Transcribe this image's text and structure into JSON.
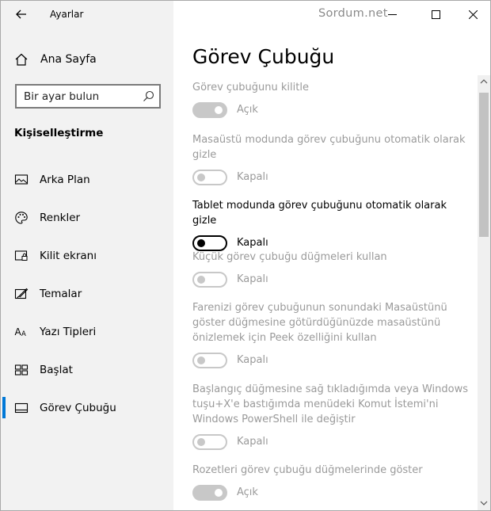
{
  "window": {
    "app_title": "Ayarlar",
    "watermark": "Sordum.net"
  },
  "sidebar": {
    "home_label": "Ana Sayfa",
    "search_placeholder": "Bir ayar bulun",
    "section_title": "Kişiselleştirme",
    "items": [
      {
        "label": "Arka Plan",
        "icon": "picture-icon"
      },
      {
        "label": "Renkler",
        "icon": "palette-icon"
      },
      {
        "label": "Kilit ekranı",
        "icon": "lock-screen-icon"
      },
      {
        "label": "Temalar",
        "icon": "brush-icon"
      },
      {
        "label": "Yazı Tipleri",
        "icon": "font-icon"
      },
      {
        "label": "Başlat",
        "icon": "start-icon"
      },
      {
        "label": "Görev Çubuğu",
        "icon": "taskbar-icon",
        "active": true
      }
    ]
  },
  "main": {
    "title": "Görev Çubuğu",
    "settings": [
      {
        "label": "Görev çubuğunu kilitle",
        "state": "Açık",
        "on": true,
        "enabled": false
      },
      {
        "label": "Masaüstü modunda görev çubuğunu otomatik olarak gizle",
        "state": "Kapalı",
        "on": false,
        "enabled": false
      },
      {
        "label": "Tablet modunda görev çubuğunu otomatik olarak gizle",
        "state": "Kapalı",
        "on": false,
        "enabled": true
      },
      {
        "label": "Küçük görev çubuğu düğmeleri kullan",
        "state": "Kapalı",
        "on": false,
        "enabled": false
      },
      {
        "label": "Farenizi görev çubuğunun sonundaki Masaüstünü göster düğmesine götürdüğünüzde masaüstünü önizlemek için Peek özelliğini kullan",
        "state": "Kapalı",
        "on": false,
        "enabled": false
      },
      {
        "label": "Başlangıç düğmesine sağ tıkladığımda veya Windows tuşu+X'e bastığımda menüdeki Komut İstemi'ni Windows PowerShell ile değiştir",
        "state": "Kapalı",
        "on": false,
        "enabled": false
      },
      {
        "label": "Rozetleri görev çubuğu düğmelerinde göster",
        "state": "Açık",
        "on": true,
        "enabled": false
      }
    ]
  },
  "colors": {
    "accent": "#0078d7",
    "sidebar_bg": "#f2f2f2",
    "disabled_text": "#9a9a9a"
  }
}
